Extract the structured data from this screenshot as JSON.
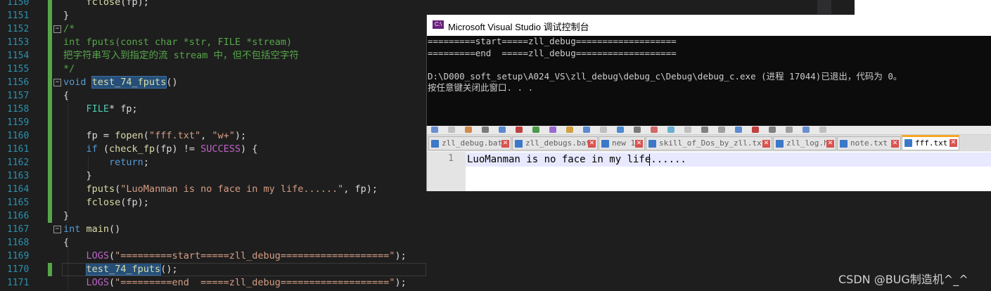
{
  "editor": {
    "lines": [
      {
        "n": "1150",
        "html": "    <span class='fn'>fclose</span>(fp);"
      },
      {
        "n": "1151",
        "html": "}"
      },
      {
        "n": "1152",
        "html": "<span class='cm'>/*</span>"
      },
      {
        "n": "1153",
        "html": "<span class='cm'>int fputs(const char *str, FILE *stream)</span>"
      },
      {
        "n": "1154",
        "html": "<span class='cm'>把字符串写入到指定的流 stream 中，但不包括空字符</span>"
      },
      {
        "n": "1155",
        "html": "<span class='cm'>*/</span>"
      },
      {
        "n": "1156",
        "html": "<span class='kw'>void</span> <span class='fn hl'>test_74_fputs</span>()"
      },
      {
        "n": "1157",
        "html": "{"
      },
      {
        "n": "1158",
        "html": "    <span class='ty'>FILE</span>* fp;"
      },
      {
        "n": "1159",
        "html": ""
      },
      {
        "n": "1160",
        "html": "    fp = <span class='fn'>fopen</span>(<span class='str'>\"fff.txt\"</span>, <span class='str'>\"w+\"</span>);"
      },
      {
        "n": "1161",
        "html": "    <span class='kw'>if</span> (<span class='fn'>check_fp</span>(fp) != <span class='mac'>SUCCESS</span>) {"
      },
      {
        "n": "1162",
        "html": "        <span class='kw'>return</span>;"
      },
      {
        "n": "1163",
        "html": "    }"
      },
      {
        "n": "1164",
        "html": "    <span class='fn'>fputs</span>(<span class='str'>\"LuoManman is no face in my life......\"</span>, fp);"
      },
      {
        "n": "1165",
        "html": "    <span class='fn'>fclose</span>(fp);"
      },
      {
        "n": "1166",
        "html": "}"
      },
      {
        "n": "1167",
        "html": "<span class='kw'>int</span> <span class='fn'>main</span>()"
      },
      {
        "n": "1168",
        "html": "{"
      },
      {
        "n": "1169",
        "html": "    <span class='mac'>LOGS</span>(<span class='str'>\"=========start=====zll_debug===================\"</span>);"
      },
      {
        "n": "1170",
        "html": "    <span class='fn hl'>test_74_fputs</span>();"
      },
      {
        "n": "1171",
        "html": "    <span class='mac'>LOGS</span>(<span class='str'>\"=========end  =====zll_debug===================\"</span>);"
      }
    ]
  },
  "console": {
    "title": "Microsoft Visual Studio 调试控制台",
    "icon_text": "C:\\",
    "output": [
      "=========start=====zll_debug===================",
      "=========end  =====zll_debug===================",
      "",
      "D:\\D000_soft_setup\\A024_VS\\zll_debug\\debug_c\\Debug\\debug_c.exe (进程 17044)已退出，代码为 0。",
      "按任意键关闭此窗口. . ."
    ]
  },
  "notepad": {
    "tabs": [
      {
        "label": "zll_debug.bat"
      },
      {
        "label": "zll_debugs.bat"
      },
      {
        "label": "new 1"
      },
      {
        "label": "skill_of_Dos_by_zll.txt"
      },
      {
        "label": "zll_log.h"
      },
      {
        "label": "note.txt"
      },
      {
        "label": "fff.txt"
      }
    ],
    "line_number": "1",
    "content": "LuoManman is no face in my life......"
  },
  "watermark": "CSDN @BUG制造机^_^"
}
